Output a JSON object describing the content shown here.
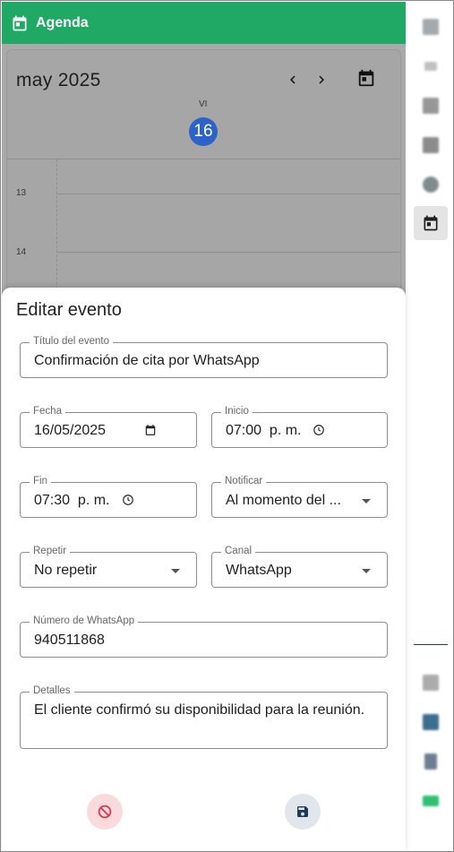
{
  "header": {
    "title": "Agenda"
  },
  "calendar": {
    "month_label": "may 2025",
    "weekday": "VI",
    "day_number": "16",
    "hours": [
      "13",
      "14"
    ]
  },
  "sidebar": {
    "items": [
      {
        "icon": "chart-icon",
        "color": "#9aa0a6"
      },
      {
        "icon": "pin-icon",
        "color": "#b0b0b0"
      },
      {
        "icon": "user-icon",
        "color": "#8e8e8e"
      },
      {
        "icon": "flag-icon",
        "color": "#8a8a8a"
      },
      {
        "icon": "settings-icon",
        "color": "#7f8c8d"
      },
      {
        "icon": "calendar-icon",
        "color": "#1f1f1f",
        "active": true
      },
      {
        "icon": "chat-icon",
        "color": "#a6a6a6"
      },
      {
        "icon": "people-icon",
        "color": "#3c6e8f"
      },
      {
        "icon": "doc-icon",
        "color": "#6c7f92"
      },
      {
        "icon": "money-icon",
        "color": "#2fbf71"
      }
    ]
  },
  "modal": {
    "title": "Editar evento",
    "fields": {
      "title": {
        "label": "Título del evento",
        "value": "Confirmación de cita por WhatsApp"
      },
      "date": {
        "label": "Fecha",
        "value": "16/05/2025"
      },
      "start": {
        "label": "Inicio",
        "value": "07:00  p. m."
      },
      "end": {
        "label": "Fin",
        "value": "07:30  p. m."
      },
      "notify": {
        "label": "Notificar",
        "value": "Al momento del ..."
      },
      "repeat": {
        "label": "Repetir",
        "value": "No repetir"
      },
      "channel": {
        "label": "Canal",
        "value": "WhatsApp"
      },
      "whatsapp": {
        "label": "Número de WhatsApp",
        "value": "940511868"
      },
      "details": {
        "label": "Detalles",
        "value": "El cliente confirmó su disponibilidad para la reunión."
      }
    }
  },
  "colors": {
    "header": "#20a965",
    "today": "#2d63c8",
    "cancel_bg": "#fadadd",
    "cancel_fg": "#e0344b",
    "save_bg": "#e1e6ec",
    "save_fg": "#1f3a57"
  }
}
